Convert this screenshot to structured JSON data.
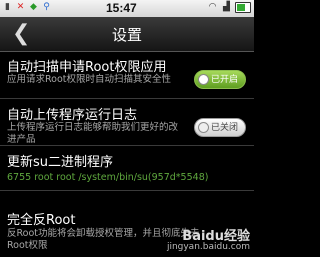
{
  "status": {
    "time": "15:47",
    "left_icons": [
      "signal-icon",
      "app-icon",
      "notification-icon",
      "usb-icon"
    ],
    "right_icons": [
      "wifi-icon",
      "signal-bars-icon",
      "battery-icon"
    ]
  },
  "titlebar": {
    "back_glyph": "❮",
    "title": "设置"
  },
  "settings": [
    {
      "title": "自动扫描申请Root权限应用",
      "subtitle": "应用请求Root权限时自动扫描其安全性",
      "toggle": "已开启"
    },
    {
      "title": "自动上传程序运行日志",
      "subtitle": "上传程序运行日志能够帮助我们更好的改进产品",
      "toggle": "已关闭"
    },
    {
      "title": "更新su二进制程序",
      "subtitle": "6755  root  root  /system/bin/su(957d*5548)"
    },
    {
      "title": "完全反Root",
      "subtitle": "反Root功能将会卸载授权管理，并且彻底失去Root权限"
    }
  ],
  "watermark": {
    "logo": "Baidu经验",
    "url": "jingyan.baidu.com"
  }
}
